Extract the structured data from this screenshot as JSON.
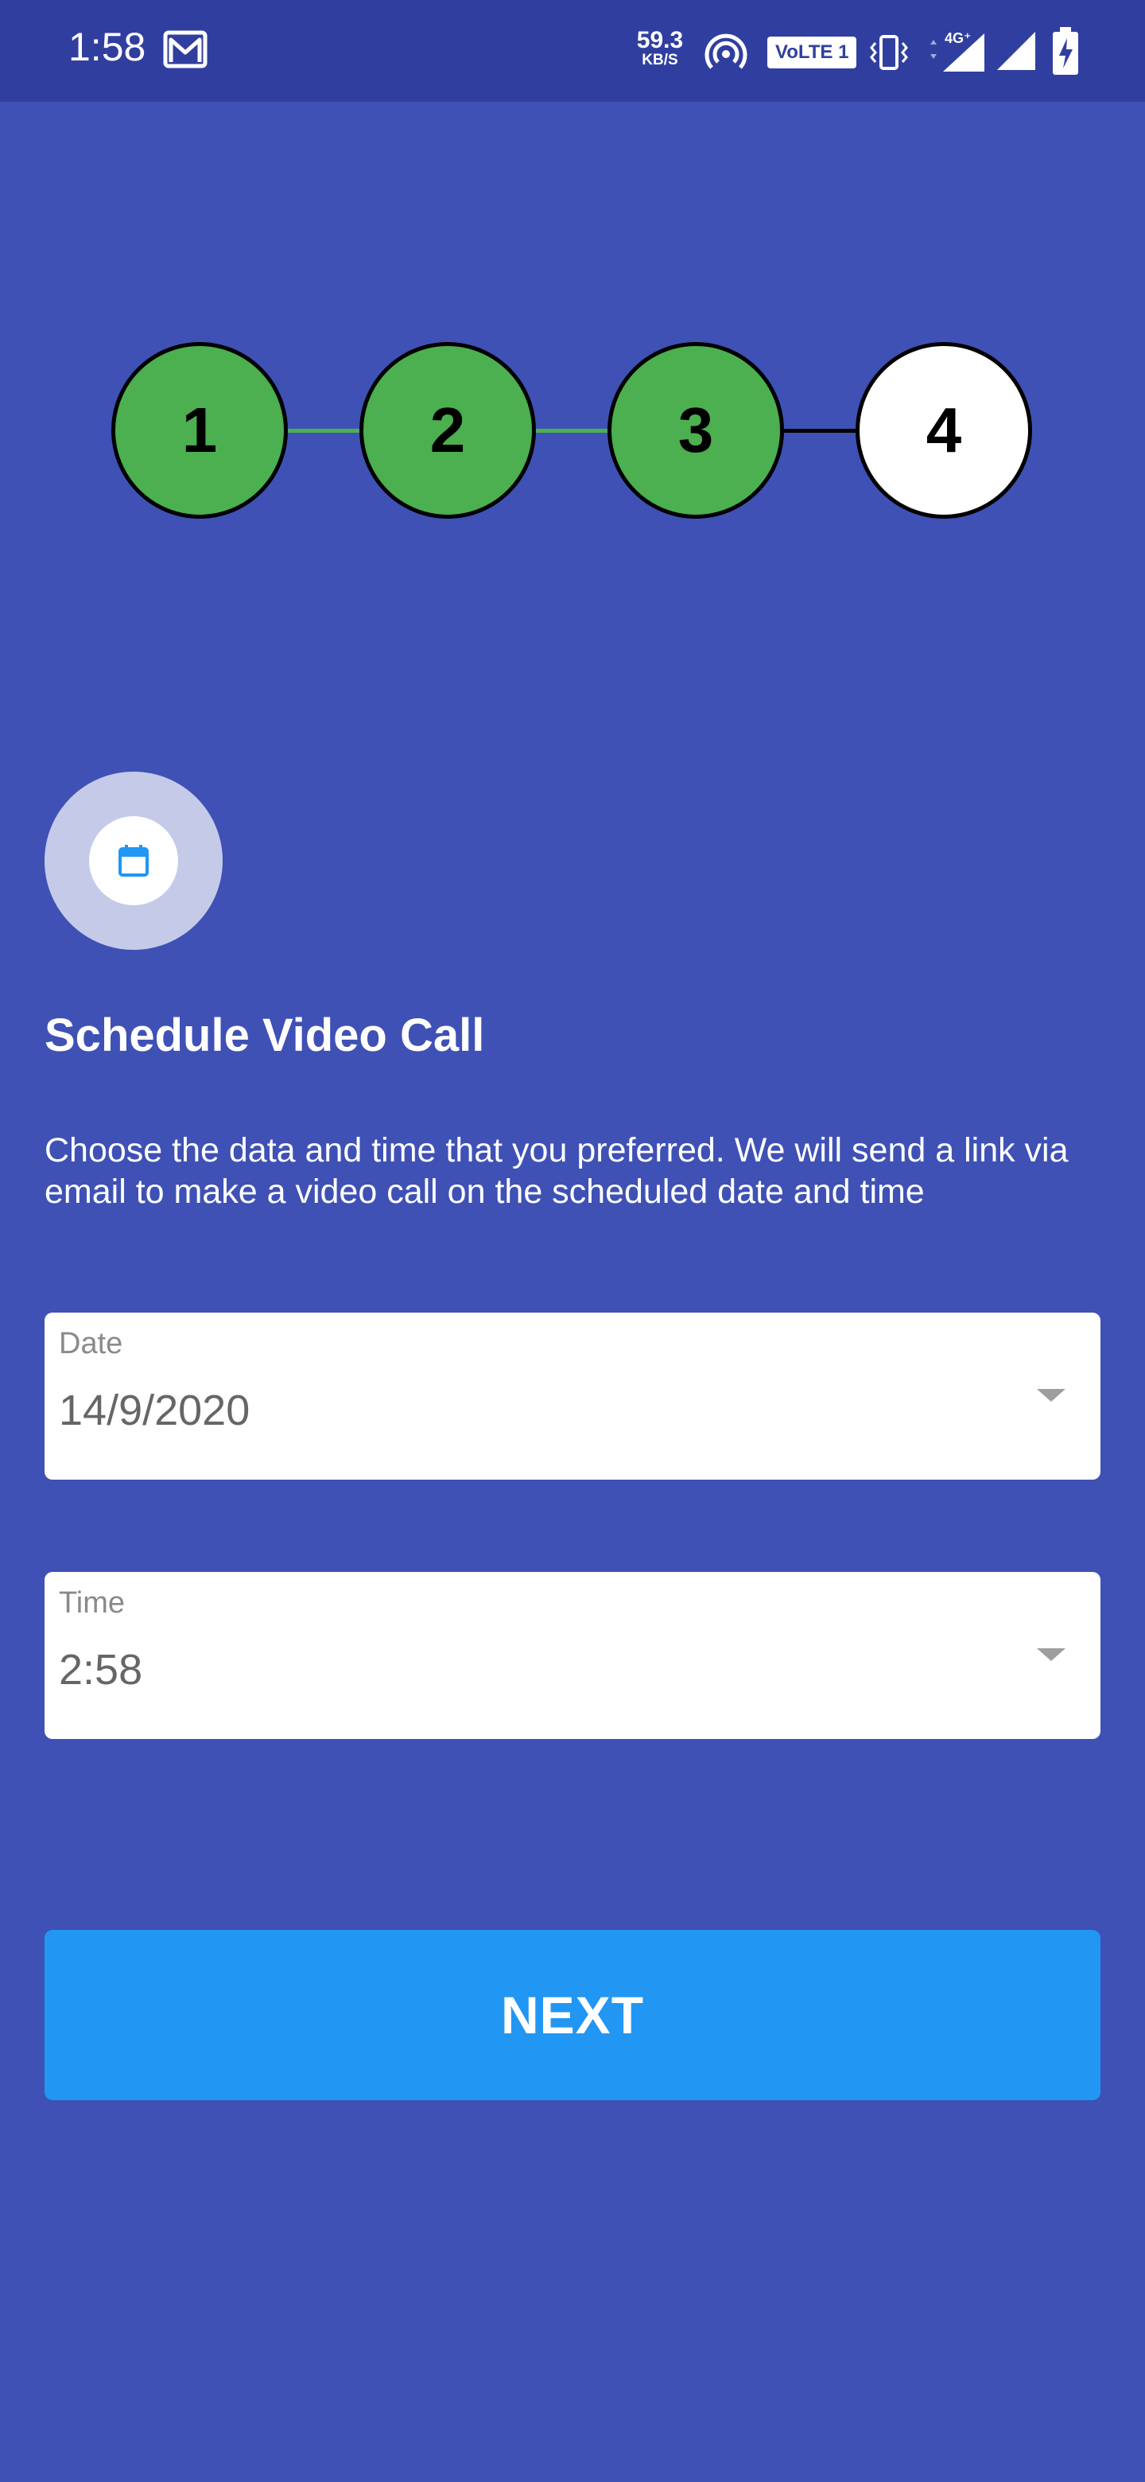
{
  "status_bar": {
    "time": "1:58",
    "net_speed_value": "59.3",
    "net_speed_unit": "KB/S",
    "volte_label": "VoLTE 1",
    "network_type": "4G⁺"
  },
  "stepper": {
    "steps": [
      {
        "label": "1",
        "state": "done"
      },
      {
        "label": "2",
        "state": "done"
      },
      {
        "label": "3",
        "state": "done"
      },
      {
        "label": "4",
        "state": "current"
      }
    ],
    "colors": {
      "done": "#4caf50",
      "current": "#ffffff",
      "connector_done": "#4caf50",
      "connector_pending": "#000000"
    }
  },
  "schedule": {
    "icon": "calendar-icon",
    "title": "Schedule Video Call",
    "description": "Choose the data and time that you preferred. We will send a link via email to make a video call on the scheduled date and time"
  },
  "date_field": {
    "label": "Date",
    "value": "14/9/2020"
  },
  "time_field": {
    "label": "Time",
    "value": "2:58"
  },
  "next_button": {
    "label": "NEXT"
  },
  "colors": {
    "background": "#3f51b5",
    "status_bar": "#303f9f",
    "button": "#2196f3",
    "icon_circle": "#c5cae9"
  }
}
